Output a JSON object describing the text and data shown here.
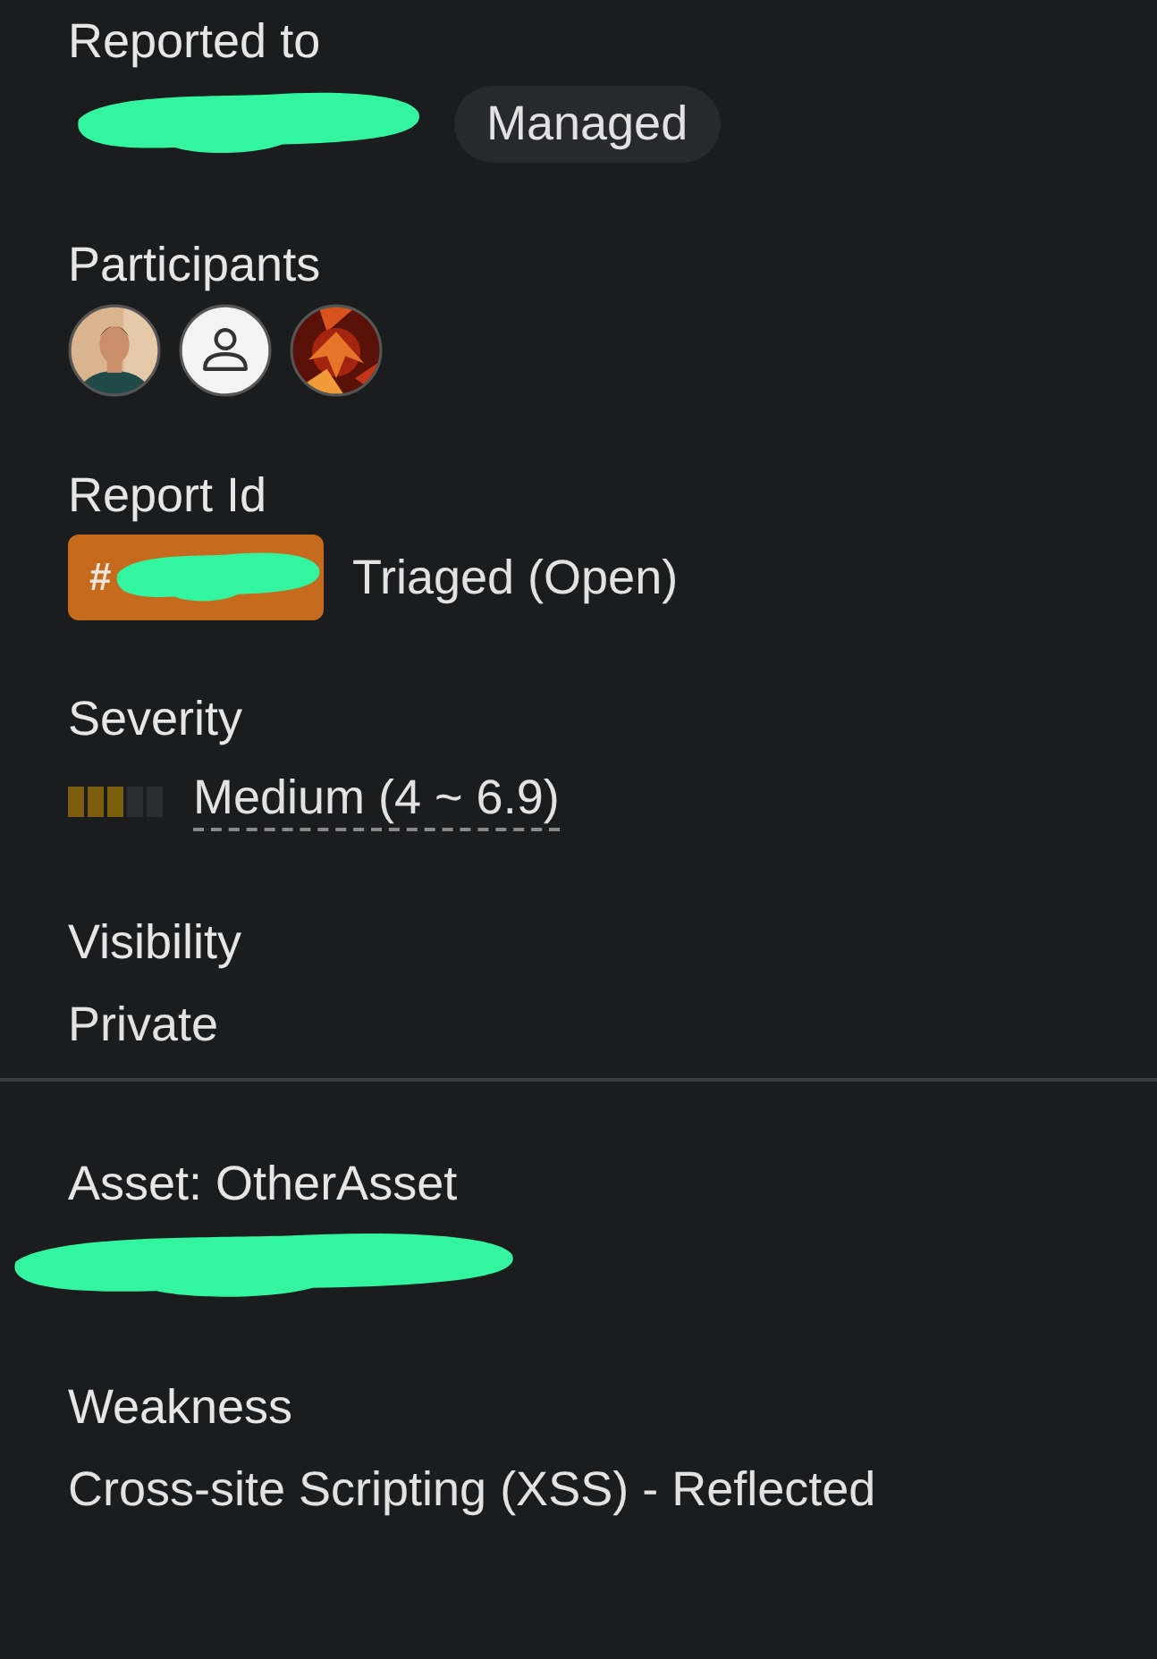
{
  "groups": [
    [
      {
        "label": "Reported to",
        "items": [
          {
            "kind": "redaction"
          },
          {
            "kind": "pill",
            "text": "Managed"
          }
        ]
      },
      {
        "label": "Participants",
        "items": [
          {
            "kind": "avatars",
            "avatars": [
              {
                "kind": "person"
              },
              {
                "kind": "default"
              },
              {
                "kind": "fire"
              }
            ]
          }
        ]
      },
      {
        "label": "Report Id",
        "items": [
          {
            "kind": "id_badge",
            "text": "#"
          },
          {
            "kind": "text",
            "text": "Triaged (Open)"
          }
        ]
      },
      {
        "label": "Severity",
        "items": [
          {
            "kind": "meter",
            "level": 0.6
          },
          {
            "kind": "underlined",
            "text": "Medium (4 ~ 6.9)"
          }
        ]
      },
      {
        "label": "Visibility",
        "items": [
          {
            "kind": "text",
            "text": "Private"
          }
        ]
      }
    ],
    [
      {
        "label": "Asset: OtherAsset",
        "items": [
          {
            "kind": "wide_redaction"
          }
        ]
      },
      {
        "label": "Weakness",
        "items": [
          {
            "kind": "text",
            "text": "Cross-site Scripting (XSS) - Reflected"
          }
        ]
      }
    ]
  ]
}
